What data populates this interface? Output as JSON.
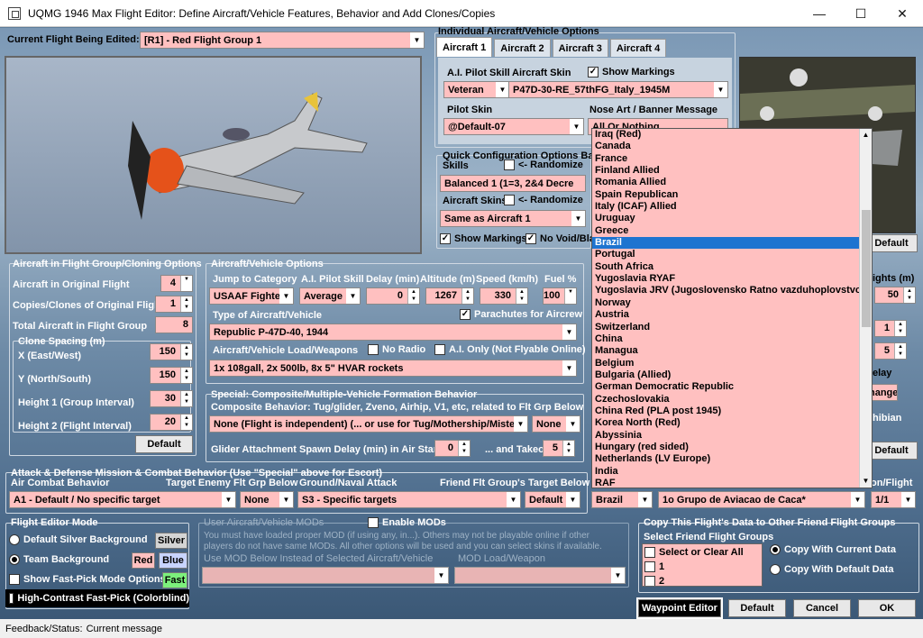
{
  "window": {
    "title": "UQMG 1946 Max Flight Editor:  Define Aircraft/Vehicle Features, Behavior and Add Clones/Copies"
  },
  "current_flight": {
    "label": "Current Flight Being Edited:",
    "value": "[R1] -  Red Flight Group  1"
  },
  "individual": {
    "title": "Individual Aircraft/Vehicle Options",
    "tabs": [
      "Aircraft 1",
      "Aircraft 2",
      "Aircraft 3",
      "Aircraft 4"
    ],
    "ai_skill_label": "A.I. Pilot Skill",
    "ai_skill_value": "Veteran",
    "skin_label": "Aircraft Skin",
    "skin_value": "P47D-30-RE_57thFG_Italy_1945M",
    "show_markings": "Show Markings",
    "pilot_skin_label": "Pilot Skin",
    "pilot_skin_value": "@Default-07",
    "nose_art_label": "Nose Art / Banner Message",
    "nose_art_value": "All Or Nothing"
  },
  "quick": {
    "title": "Quick Configuration Options Base",
    "skills_label": "Skills",
    "randomize1": "<- Randomize",
    "skills_value": "Balanced 1 (1=3, 2&4 Decre",
    "skins_label": "Aircraft Skins",
    "randomize2": "<- Randomize",
    "skins_value": "Same as Aircraft 1",
    "show_markings": "Show Markings",
    "no_void": "No Void/Bla"
  },
  "flight_group": {
    "title": "Aircraft in Flight Group/Cloning Options",
    "in_original_label": "Aircraft in Original Flight",
    "in_original": "4",
    "copies_label": "Copies/Clones of Original Flight",
    "copies": "1",
    "total_label": "Total Aircraft in Flight Group",
    "total": "8",
    "spacing_title": "Clone Spacing (m)",
    "x_label": "X (East/West)",
    "x": "150",
    "y_label": "Y (North/South)",
    "y": "150",
    "h1_label": "Height 1 (Group Interval)",
    "h1": "30",
    "h2_label": "Height 2 (Flight Interval)",
    "h2": "20",
    "default_btn": "Default"
  },
  "vehicle": {
    "title": "Aircraft/Vehicle Options",
    "jump_label": "Jump to Category",
    "jump_value": "USAAF Fighter",
    "skill_label": "A.I. Pilot Skill",
    "skill_value": "Average",
    "delay_label": "Delay (min)",
    "delay": "0",
    "alt_label": "Altitude (m)",
    "alt": "1267",
    "speed_label": "Speed (km/h)",
    "speed": "330",
    "fuel_label": "Fuel %",
    "fuel": "100",
    "type_label": "Type of Aircraft/Vehicle",
    "type_value": "Republic P-47D-40, 1944",
    "parachutes": "Parachutes for Aircrew",
    "load_label": "Aircraft/Vehicle Load/Weapons",
    "no_radio": "No Radio",
    "ai_only": "A.I. Only (Not Flyable Online)",
    "load_value": "1x 108gall, 2x 500lb, 8x 5\" HVAR rockets"
  },
  "special": {
    "title": "Special: Composite/Multiple-Vehicle Formation Behavior",
    "composite_label": "Composite Behavior: Tug/glider, Zveno, Airhip, V1, etc, related to Flt Grp Below",
    "composite_value": "None (Flight is independent) (... or use for Tug/Mothership/Mistel Bo",
    "composite_value2": "None",
    "glider_label": "Glider Attachment Spawn Delay (min) in Air Start",
    "glider": "0",
    "takeoff_label": "... and Takeoff",
    "takeoff": "5"
  },
  "attack": {
    "title": "Attack & Defense Mission & Combat Behavior (Use \"Special\" above for Escort)",
    "air_label": "Air Combat Behavior",
    "air_value": "A1 - Default / No specific target",
    "target_label": "Target Enemy Flt Grp Below",
    "target_value": "None",
    "ground_label": "Ground/Naval Attack",
    "ground_value": "S3 - Specific targets",
    "friend_label": "Friend Flt Group's Target Below",
    "friend_value": "Default"
  },
  "mode": {
    "title": "Flight Editor Mode",
    "default_silver": "Default Silver Background",
    "silver_btn": "Silver",
    "team": "Team Background",
    "red_btn": "Red",
    "blue_btn": "Blue",
    "fastpick": "Show Fast-Pick Mode Options",
    "fast_btn": "Fast",
    "contrast": "High-Contrast Fast-Pick (Colorblind)"
  },
  "mods": {
    "title": "User Aircraft/Vehicle MODs",
    "enable": "Enable MODs",
    "note1": "You must have loaded proper MOD (if using any, in...).  Others may not be playable online if other",
    "note2": "players do not have same MODs.  All other options will be used and you can select skins if available.",
    "use_label": "Use MOD Below Instead of Selected Aircraft/Vehicle",
    "load_label": "MOD Load/Weapon"
  },
  "country_row": {
    "country": "Brazil",
    "unit": "1o Grupo de Aviacao de Caca*",
    "flight": "1/1",
    "flight_label": "on/Flight"
  },
  "copy": {
    "title": "Copy This Flight's Data to Other Friend Flight Groups",
    "select_label": "Select Friend Flight Groups",
    "items": [
      "Select or Clear All",
      "1",
      "2"
    ],
    "current": "Copy With Current Data",
    "default": "Copy With Default Data"
  },
  "right_partial": {
    "default1": "Default",
    "flights_label": "ights (m)",
    "flights": "50",
    "v1": "1",
    "v2": "5",
    "delay": "elay",
    "change": "hange",
    "hibian": "hibian",
    "default2": "Default"
  },
  "buttons": {
    "waypoint": "Waypoint Editor",
    "default": "Default",
    "cancel": "Cancel",
    "ok": "OK"
  },
  "status": {
    "label": "Feedback/Status:",
    "message": "Current message"
  },
  "country_list": {
    "items": [
      "Iraq (Red)",
      "Canada",
      "France",
      "Finland Allied",
      "Romania Allied",
      "Spain Republican",
      "Italy (ICAF) Allied",
      "Uruguay",
      "Greece",
      "Brazil",
      "Portugal",
      "South Africa",
      "Yugoslavia RYAF",
      "Yugoslavia JRV (Jugoslovensko Ratno vazduhoplovstvo)",
      "Norway",
      "Austria",
      "Switzerland",
      "China",
      "Managua",
      "Belgium",
      "Bulgaria (Allied)",
      "German Democratic Republic",
      "Czechoslovakia",
      "China Red (PLA post 1945)",
      "Korea North (Red)",
      "Abyssinia",
      "Hungary (red sided)",
      "Netherlands (LV Europe)",
      "India",
      "RAF"
    ],
    "selected_index": 9
  }
}
